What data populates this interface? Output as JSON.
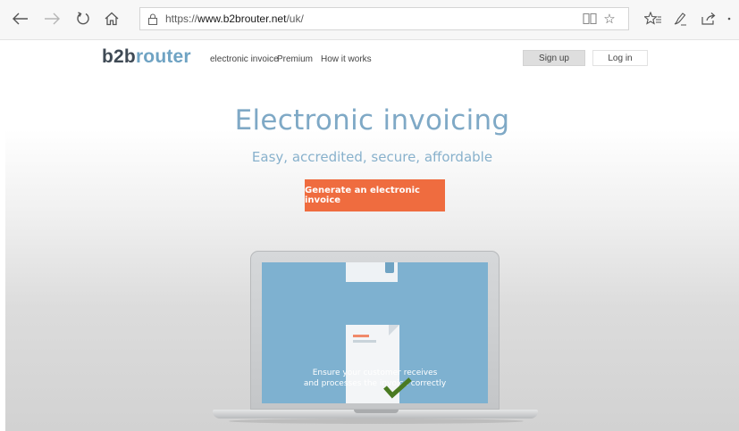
{
  "browser": {
    "url_prefix": "https://",
    "url_host": "www.b2brouter.net",
    "url_path": "/uk/",
    "icons": [
      "back-arrow-icon",
      "forward-arrow-icon",
      "refresh-icon",
      "home-icon",
      "lock-icon",
      "reading-view-icon",
      "favorite-star-icon",
      "favorites-hub-icon",
      "pen-note-icon",
      "share-icon"
    ]
  },
  "header": {
    "logo_b2b": "b2b",
    "logo_router": "router",
    "nav": {
      "electronic_invoice": "electronic invoice",
      "premium": "Premium",
      "how_it_works": "How it works"
    },
    "sign_up": "Sign up",
    "log_in": "Log in"
  },
  "hero": {
    "title": "Electronic invoicing",
    "subtitle": "Easy, accredited, secure, affordable",
    "cta": "Generate an electronic invoice"
  },
  "screen": {
    "text": "Ensure your customer receives\nand processes the invoice correctly"
  },
  "colors": {
    "accent_orange": "#ef6c3f",
    "brand_blue": "#6fa3c3",
    "title_blue": "#7fa9c6",
    "screen_blue": "#7eb1d0",
    "check_green": "#4a7a22"
  }
}
